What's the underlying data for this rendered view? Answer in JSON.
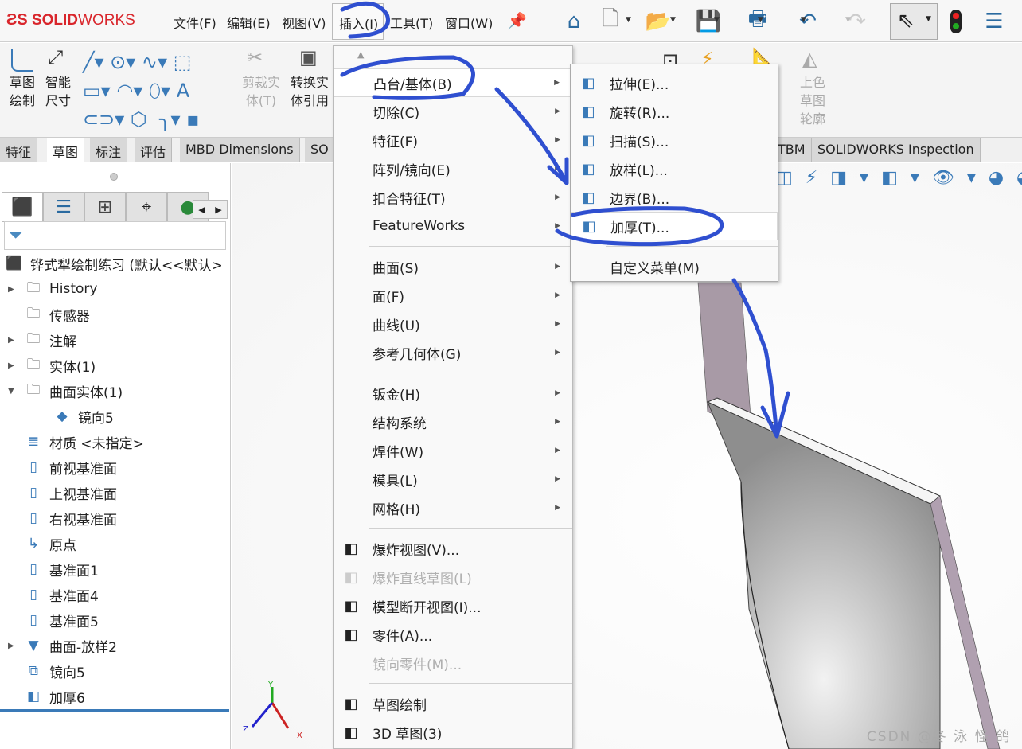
{
  "app": {
    "logo": "SOLIDWORKS"
  },
  "menubar": [
    {
      "label": "文件(F)"
    },
    {
      "label": "编辑(E)"
    },
    {
      "label": "视图(V)"
    },
    {
      "label": "插入(I)"
    },
    {
      "label": "工具(T)"
    },
    {
      "label": "窗口(W)"
    }
  ],
  "toolbar_icons": [
    "home-icon",
    "new-document-icon",
    "open-icon",
    "save-icon",
    "print-icon",
    "undo-icon",
    "redo-icon",
    "select-icon",
    "rebuild-icon",
    "options-icon"
  ],
  "ribbon": {
    "sketch": "草图绘制",
    "smart_dim": "智能尺寸",
    "trim": "剪裁实体(T)",
    "convert": "转换实体引用",
    "shaded": "上色草图轮廓"
  },
  "tabs": [
    {
      "label": "特征"
    },
    {
      "label": "草图",
      "active": true
    },
    {
      "label": "标注"
    },
    {
      "label": "评估"
    },
    {
      "label": "MBD Dimensions"
    },
    {
      "label": "SO"
    },
    {
      "label": "TBM"
    },
    {
      "label": "SOLIDWORKS Inspection"
    }
  ],
  "tree": {
    "root": "铧式犁绘制练习  (默认<<默认>",
    "items": [
      {
        "label": "History",
        "expand": true,
        "icon": "history-folder-icon"
      },
      {
        "label": "传感器",
        "icon": "sensor-folder-icon"
      },
      {
        "label": "注解",
        "expand": true,
        "icon": "annotation-folder-icon"
      },
      {
        "label": "实体(1)",
        "expand": true,
        "icon": "solid-body-folder-icon"
      },
      {
        "label": "曲面实体(1)",
        "expanded": true,
        "icon": "surface-body-folder-icon"
      },
      {
        "label": "镜向5",
        "indent": true,
        "icon": "surface-icon"
      },
      {
        "label": "材质 <未指定>",
        "icon": "material-icon"
      },
      {
        "label": "前视基准面",
        "icon": "plane-icon"
      },
      {
        "label": "上视基准面",
        "icon": "plane-icon"
      },
      {
        "label": "右视基准面",
        "icon": "plane-icon"
      },
      {
        "label": "原点",
        "icon": "origin-icon"
      },
      {
        "label": "基准面1",
        "icon": "plane-icon"
      },
      {
        "label": "基准面4",
        "icon": "plane-icon"
      },
      {
        "label": "基准面5",
        "icon": "plane-icon"
      },
      {
        "label": "曲面-放样2",
        "expand": true,
        "icon": "loft-surface-icon"
      },
      {
        "label": "镜向5",
        "icon": "mirror-icon"
      },
      {
        "label": "加厚6",
        "icon": "thicken-icon"
      }
    ]
  },
  "insert_menu": [
    {
      "label": "凸台/基体(B)",
      "sub": true,
      "highlight": true
    },
    {
      "label": "切除(C)",
      "sub": true
    },
    {
      "label": "特征(F)",
      "sub": true
    },
    {
      "label": "阵列/镜向(E)",
      "sub": true
    },
    {
      "label": "扣合特征(T)",
      "sub": true
    },
    {
      "label": "FeatureWorks",
      "sub": true
    },
    {
      "sep": true
    },
    {
      "label": "曲面(S)",
      "sub": true
    },
    {
      "label": "面(F)",
      "sub": true
    },
    {
      "label": "曲线(U)",
      "sub": true
    },
    {
      "label": "参考几何体(G)",
      "sub": true
    },
    {
      "sep": true
    },
    {
      "label": "钣金(H)",
      "sub": true
    },
    {
      "label": "结构系统",
      "sub": true
    },
    {
      "label": "焊件(W)",
      "sub": true
    },
    {
      "label": "模具(L)",
      "sub": true
    },
    {
      "label": "网格(H)",
      "sub": true
    },
    {
      "sep": true
    },
    {
      "label": "爆炸视图(V)...",
      "icon": "explode-view-icon"
    },
    {
      "label": "爆炸直线草图(L)",
      "icon": "explode-line-icon",
      "disabled": true
    },
    {
      "label": "模型断开视图(I)...",
      "icon": "model-break-icon"
    },
    {
      "label": "零件(A)...",
      "icon": "insert-part-icon"
    },
    {
      "label": "镜向零件(M)...",
      "disabled": true
    },
    {
      "sep": true
    },
    {
      "label": "草图绘制",
      "icon": "sketch-icon"
    },
    {
      "label": "3D 草图(3)",
      "icon": "3d-sketch-icon"
    }
  ],
  "boss_submenu": [
    {
      "label": "拉伸(E)...",
      "icon": "extrude-icon"
    },
    {
      "label": "旋转(R)...",
      "icon": "revolve-icon"
    },
    {
      "label": "扫描(S)...",
      "icon": "sweep-icon"
    },
    {
      "label": "放样(L)...",
      "icon": "loft-icon"
    },
    {
      "label": "边界(B)...",
      "icon": "boundary-icon"
    },
    {
      "label": "加厚(T)...",
      "icon": "thicken-icon",
      "highlight": true
    },
    {
      "sep": true
    },
    {
      "label": "自定义菜单(M)"
    }
  ],
  "watermark": "CSDN @冬 泳 怪 鸽",
  "colors": {
    "annotation_ink": "#2f4fd0",
    "logo_red": "#d9262c",
    "part_gray": "#9a9a9a"
  }
}
